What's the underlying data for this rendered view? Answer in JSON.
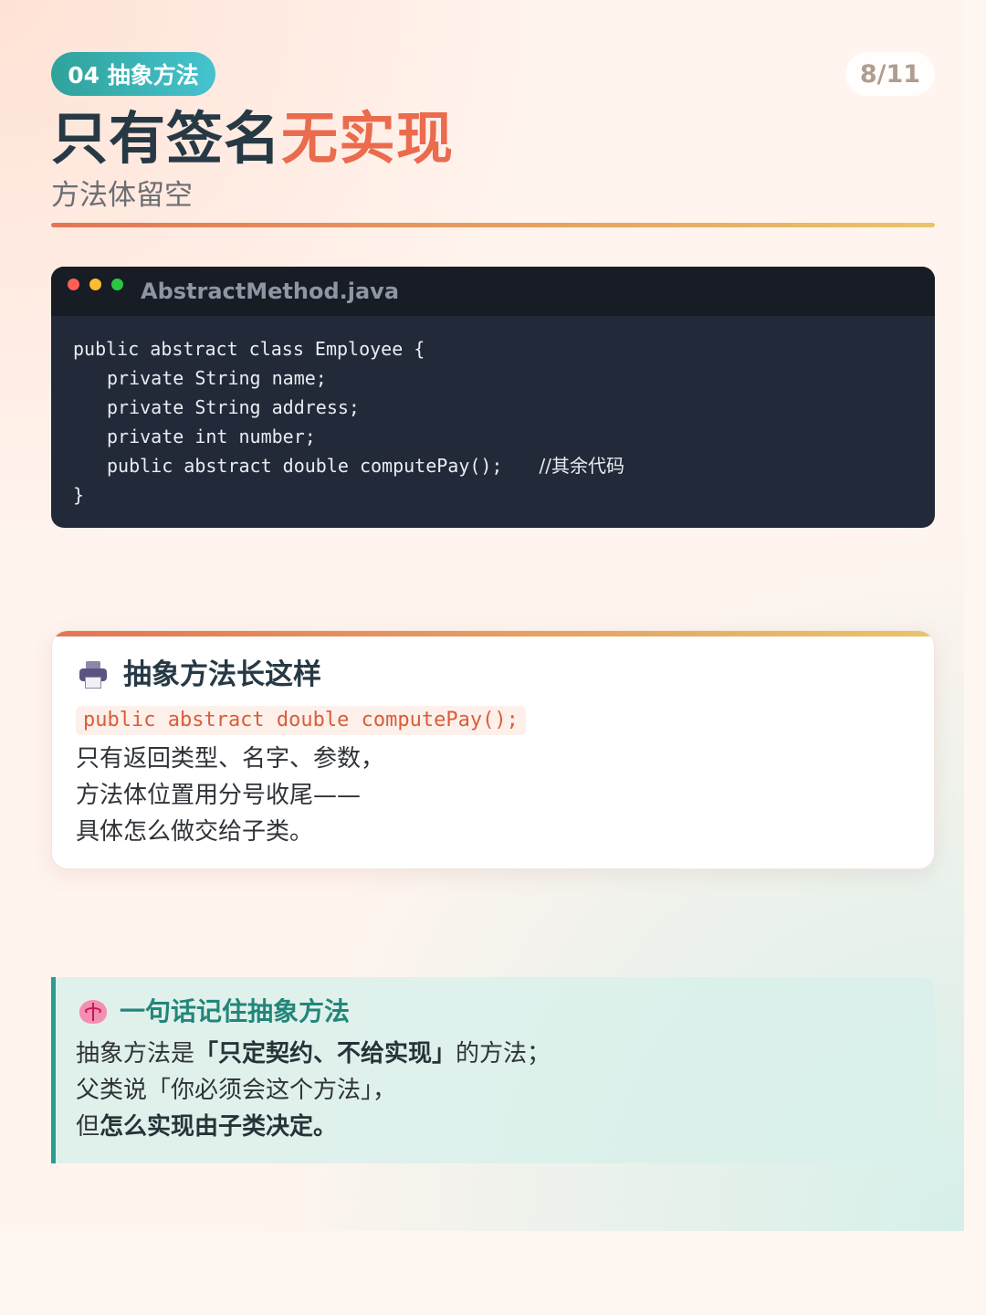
{
  "header": {
    "section_pill": "04 抽象方法",
    "page_indicator": "8/11",
    "title_part1": "只有签名",
    "title_part2": "无实现",
    "subtitle": "方法体留空"
  },
  "code_window": {
    "filename": "AbstractMethod.java",
    "lines": [
      "public abstract class Employee {",
      "private String name;",
      "private String address;",
      "private int number;",
      "public abstract double computePay();",
      "}"
    ],
    "comment": "//其余代码"
  },
  "card": {
    "icon": "printer-icon",
    "title": "抽象方法长这样",
    "code": "public abstract double computePay();",
    "lines": [
      "只有返回类型、名字、参数，",
      "方法体位置用分号收尾——",
      "具体怎么做交给子类。"
    ]
  },
  "tip": {
    "icon": "brain-icon",
    "title": "一句话记住抽象方法",
    "line1_a": "抽象方法是",
    "line1_b": "「只定契约、不给实现」",
    "line1_c": "的方法；",
    "line2": "父类说「你必须会这个方法」，",
    "line3_a": "但",
    "line3_b": "怎么实现由子类决定。"
  },
  "colors": {
    "accent_orange": "#ea6b4d",
    "accent_teal": "#2a9d8f",
    "title_dark": "#263944",
    "code_bg": "#222938"
  }
}
